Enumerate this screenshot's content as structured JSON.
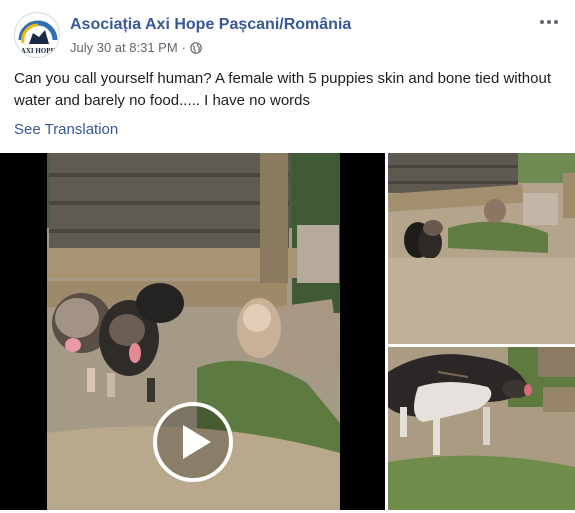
{
  "post": {
    "author": "Asociația Axi Hope Pașcani/România",
    "timestamp": "July 30 at 8:31 PM",
    "separator": "·",
    "privacy_icon": "globe-icon",
    "avatar_text": "AXI HOPE",
    "more_icon": "more-options-icon",
    "text": "Can you call yourself human? A female with 5 puppies skin and bone tied without water and barely no food..... I have no words",
    "see_translation": "See Translation"
  },
  "media": {
    "video": {
      "play_icon": "play-icon"
    },
    "thumbnails": [
      "puppies-by-doghouse-photo",
      "chained-dog-photo"
    ]
  },
  "colors": {
    "link": "#385898",
    "meta": "#616770",
    "text": "#1c1e21",
    "video_bg": "#000000"
  }
}
